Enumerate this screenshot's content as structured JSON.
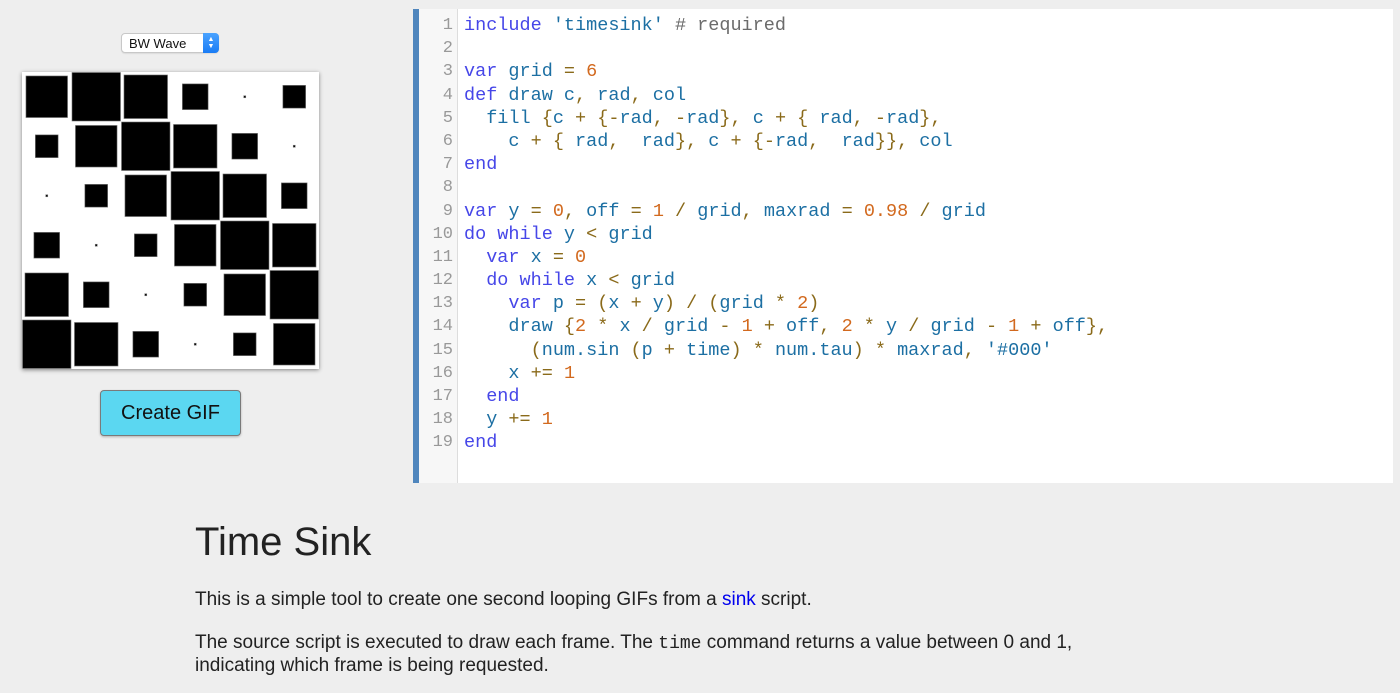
{
  "preset_select": {
    "value": "BW Wave"
  },
  "preview": {
    "grid": 6,
    "fill_color": "#000000",
    "background": "#ffffff",
    "square_size_fraction_of_cell": [
      [
        0.84,
        0.98,
        0.88,
        0.52,
        0.02,
        0.46
      ],
      [
        0.46,
        0.84,
        0.98,
        0.88,
        0.52,
        0.02
      ],
      [
        0.02,
        0.46,
        0.84,
        0.98,
        0.88,
        0.52
      ],
      [
        0.52,
        0.02,
        0.46,
        0.84,
        0.98,
        0.88
      ],
      [
        0.88,
        0.52,
        0.02,
        0.46,
        0.84,
        0.98
      ],
      [
        0.98,
        0.88,
        0.52,
        0.02,
        0.46,
        0.84
      ]
    ]
  },
  "create_button": {
    "label": "Create GIF",
    "color": "#5bd7f1"
  },
  "editor": {
    "accent": "#4f86bd",
    "lines": [
      [
        [
          "kw",
          "include"
        ],
        [
          "",
          "' "
        ],
        [
          "str",
          "'timesink'"
        ],
        [
          "com",
          " # required"
        ]
      ],
      [],
      [
        [
          "kw",
          "var"
        ],
        [
          "",
          ""
        ],
        [
          "id",
          " grid"
        ],
        [
          "op",
          " ="
        ],
        [
          "num",
          " 6"
        ]
      ],
      [
        [
          "kw",
          "def"
        ],
        [
          "id",
          " draw c"
        ],
        [
          "op",
          ","
        ],
        [
          "id",
          " rad"
        ],
        [
          "op",
          ","
        ],
        [
          "id",
          " col"
        ]
      ],
      [
        [
          "id",
          "  fill "
        ],
        [
          "op",
          "{"
        ],
        [
          "id",
          "c "
        ],
        [
          "op",
          "+ {-"
        ],
        [
          "id",
          "rad"
        ],
        [
          "op",
          ", -"
        ],
        [
          "id",
          "rad"
        ],
        [
          "op",
          "}, "
        ],
        [
          "id",
          "c "
        ],
        [
          "op",
          "+ { "
        ],
        [
          "id",
          "rad"
        ],
        [
          "op",
          ", -"
        ],
        [
          "id",
          "rad"
        ],
        [
          "op",
          "},"
        ]
      ],
      [
        [
          "id",
          "    c "
        ],
        [
          "op",
          "+ { "
        ],
        [
          "id",
          "rad"
        ],
        [
          "op",
          ",  "
        ],
        [
          "id",
          "rad"
        ],
        [
          "op",
          "}, "
        ],
        [
          "id",
          "c "
        ],
        [
          "op",
          "+ {-"
        ],
        [
          "id",
          "rad"
        ],
        [
          "op",
          ",  "
        ],
        [
          "id",
          "rad"
        ],
        [
          "op",
          "}}, "
        ],
        [
          "id",
          "col"
        ]
      ],
      [
        [
          "kw",
          "end"
        ]
      ],
      [],
      [
        [
          "kw",
          "var"
        ],
        [
          "id",
          " y "
        ],
        [
          "op",
          "= "
        ],
        [
          "num",
          "0"
        ],
        [
          "op",
          ", "
        ],
        [
          "id",
          "off "
        ],
        [
          "op",
          "= "
        ],
        [
          "num",
          "1"
        ],
        [
          "op",
          " / "
        ],
        [
          "id",
          "grid"
        ],
        [
          "op",
          ", "
        ],
        [
          "id",
          "maxrad "
        ],
        [
          "op",
          "= "
        ],
        [
          "num",
          "0.98"
        ],
        [
          "op",
          " / "
        ],
        [
          "id",
          "grid"
        ]
      ],
      [
        [
          "kw",
          "do while"
        ],
        [
          "id",
          " y "
        ],
        [
          "op",
          "< "
        ],
        [
          "id",
          "grid"
        ]
      ],
      [
        [
          "kw",
          "  var"
        ],
        [
          "id",
          " x "
        ],
        [
          "op",
          "= "
        ],
        [
          "num",
          "0"
        ]
      ],
      [
        [
          "kw",
          "  do while"
        ],
        [
          "id",
          " x "
        ],
        [
          "op",
          "< "
        ],
        [
          "id",
          "grid"
        ]
      ],
      [
        [
          "kw",
          "    var"
        ],
        [
          "id",
          " p "
        ],
        [
          "op",
          "= ("
        ],
        [
          "id",
          "x "
        ],
        [
          "op",
          "+ "
        ],
        [
          "id",
          "y"
        ],
        [
          "op",
          ") / ("
        ],
        [
          "id",
          "grid "
        ],
        [
          "op",
          "* "
        ],
        [
          "num",
          "2"
        ],
        [
          "op",
          ")"
        ]
      ],
      [
        [
          "id",
          "    draw "
        ],
        [
          "op",
          "{"
        ],
        [
          "num",
          "2"
        ],
        [
          "op",
          " * "
        ],
        [
          "id",
          "x "
        ],
        [
          "op",
          "/ "
        ],
        [
          "id",
          "grid "
        ],
        [
          "op",
          "- "
        ],
        [
          "num",
          "1"
        ],
        [
          "op",
          " + "
        ],
        [
          "id",
          "off"
        ],
        [
          "op",
          ", "
        ],
        [
          "num",
          "2"
        ],
        [
          "op",
          " * "
        ],
        [
          "id",
          "y "
        ],
        [
          "op",
          "/ "
        ],
        [
          "id",
          "grid "
        ],
        [
          "op",
          "- "
        ],
        [
          "num",
          "1"
        ],
        [
          "op",
          " + "
        ],
        [
          "id",
          "off"
        ],
        [
          "op",
          "},"
        ]
      ],
      [
        [
          "op",
          "      ("
        ],
        [
          "id",
          "num.sin "
        ],
        [
          "op",
          "("
        ],
        [
          "id",
          "p "
        ],
        [
          "op",
          "+ "
        ],
        [
          "id",
          "time"
        ],
        [
          "op",
          ") * "
        ],
        [
          "id",
          "num.tau"
        ],
        [
          "op",
          ") * "
        ],
        [
          "id",
          "maxrad"
        ],
        [
          "op",
          ", "
        ],
        [
          "str",
          "'#000'"
        ]
      ],
      [
        [
          "id",
          "    x "
        ],
        [
          "op",
          "+= "
        ],
        [
          "num",
          "1"
        ]
      ],
      [
        [
          "kw",
          "  end"
        ]
      ],
      [
        [
          "id",
          "  y "
        ],
        [
          "op",
          "+= "
        ],
        [
          "num",
          "1"
        ]
      ],
      [
        [
          "kw",
          "end"
        ]
      ]
    ]
  },
  "about": {
    "title": "Time Sink",
    "p1_before": "This is a simple tool to create one second looping GIFs from a ",
    "p1_link": "sink",
    "p1_after": " script.",
    "p2_before": "The source script is executed to draw each frame. The ",
    "p2_code": "time",
    "p2_after": " command returns a value between 0 and 1, indicating which frame is being requested."
  }
}
